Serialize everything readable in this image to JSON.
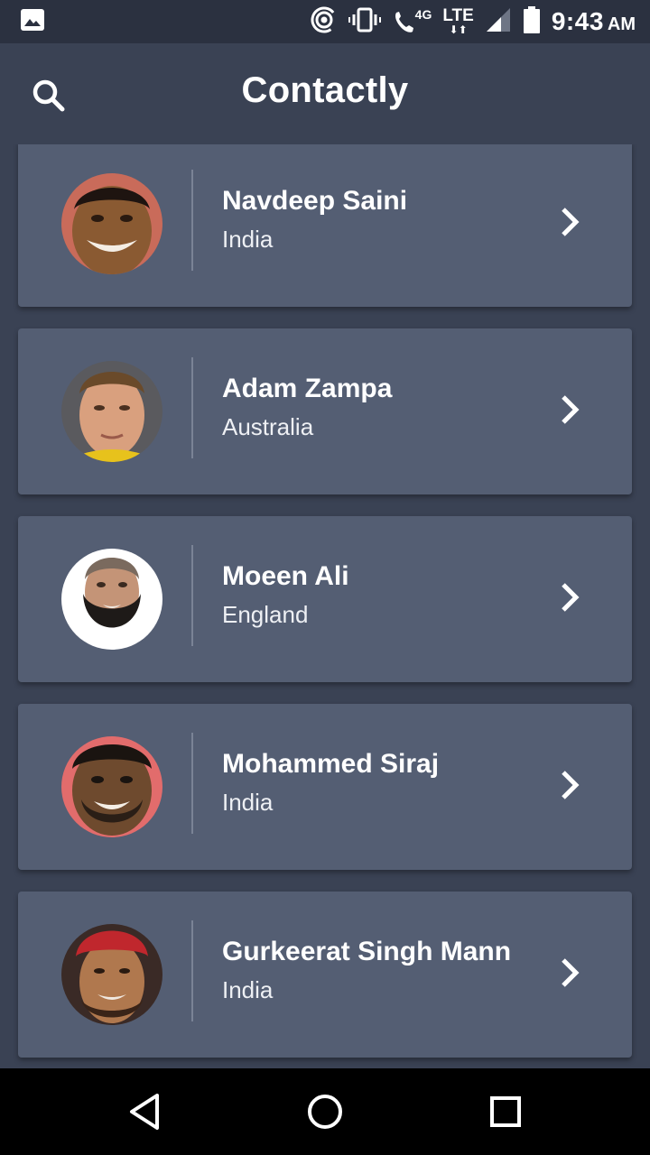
{
  "status_bar": {
    "network_label": "4G",
    "lte_label": "LTE",
    "lte_arrows": "⬇⬆",
    "time": "9:43",
    "ampm": "AM"
  },
  "app_bar": {
    "title": "Contactly",
    "search_icon": "search-icon"
  },
  "contacts": [
    {
      "name": "Navdeep Saini",
      "country": "India"
    },
    {
      "name": "Adam Zampa",
      "country": "Australia"
    },
    {
      "name": "Moeen Ali",
      "country": "England"
    },
    {
      "name": "Mohammed Siraj",
      "country": "India"
    },
    {
      "name": "Gurkeerat Singh Mann",
      "country": "India"
    }
  ],
  "colors": {
    "background": "#3a4254",
    "card": "#545e73",
    "status_bar": "#2b3140",
    "nav_bar": "#000000",
    "text": "#ffffff"
  },
  "nav_bar": {
    "back_icon": "back-triangle-icon",
    "home_icon": "home-circle-icon",
    "recents_icon": "recents-square-icon"
  }
}
